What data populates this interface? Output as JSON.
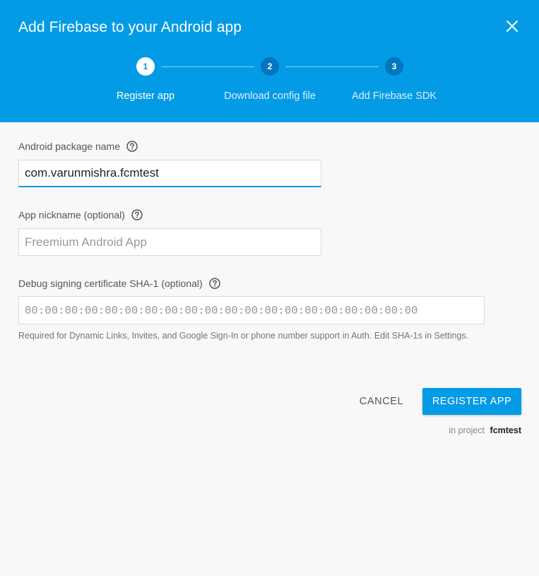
{
  "dialog": {
    "title": "Add Firebase to your Android app",
    "close_icon": "close-icon"
  },
  "stepper": {
    "steps": [
      {
        "number": "1",
        "label": "Register app",
        "active": true
      },
      {
        "number": "2",
        "label": "Download config file",
        "active": false
      },
      {
        "number": "3",
        "label": "Add Firebase SDK",
        "active": false
      }
    ]
  },
  "form": {
    "package_name": {
      "label": "Android package name",
      "value": "com.varunmishra.fcmtest",
      "help_icon": "help-circle-icon"
    },
    "nickname": {
      "label": "App nickname (optional)",
      "value": "",
      "placeholder": "Freemium Android App",
      "help_icon": "help-circle-icon"
    },
    "sha1": {
      "label": "Debug signing certificate SHA-1 (optional)",
      "value": "",
      "placeholder": "00:00:00:00:00:00:00:00:00:00:00:00:00:00:00:00:00:00:00:00",
      "help_icon": "help-circle-icon",
      "hint": "Required for Dynamic Links, Invites, and Google Sign-In or phone number support in Auth. Edit SHA-1s in Settings."
    }
  },
  "actions": {
    "cancel_label": "CANCEL",
    "register_label": "REGISTER APP",
    "project_prefix": "in project",
    "project_name": "fcmtest"
  },
  "colors": {
    "header_bg": "#039be5",
    "accent": "#039be5",
    "page_bg": "#f8f8f8"
  }
}
